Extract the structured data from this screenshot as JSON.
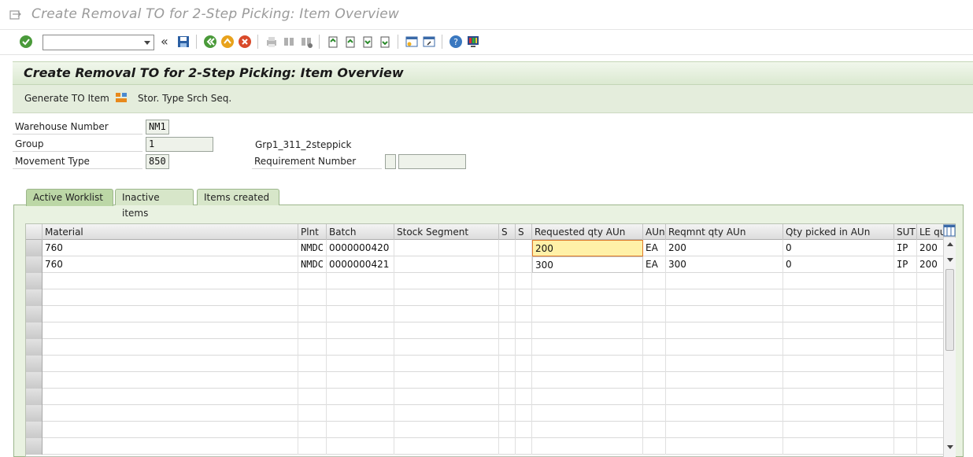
{
  "window": {
    "title": "Create Removal TO for 2-Step Picking: Item Overview"
  },
  "toolbar": {
    "command_field_value": "",
    "icons": [
      "enter-icon",
      "save-icon",
      "back-icon",
      "exit-icon",
      "cancel-icon",
      "print-icon",
      "find-icon",
      "find-next-icon",
      "first-page-icon",
      "previous-page-icon",
      "next-page-icon",
      "last-page-icon",
      "create-session-icon",
      "shortcut-icon",
      "help-icon",
      "customize-layout-icon"
    ]
  },
  "header": {
    "title": "Create Removal TO for 2-Step Picking: Item Overview"
  },
  "app_toolbar": {
    "generate_label": "Generate TO Item",
    "stor_type_label": "Stor. Type Srch Seq."
  },
  "form": {
    "warehouse_label": "Warehouse Number",
    "warehouse_value": "NM1",
    "group_label": "Group",
    "group_value": "1",
    "group_desc": "Grp1_311_2steppick",
    "movement_label": "Movement Type",
    "movement_value": "850",
    "requirement_label": "Requirement Number",
    "requirement_type": "",
    "requirement_value": ""
  },
  "tabs": [
    {
      "label": "Active Worklist",
      "active": true
    },
    {
      "label": "Inactive items",
      "active": false
    },
    {
      "label": "Items created",
      "active": false
    }
  ],
  "table": {
    "columns": [
      "Material",
      "Plnt",
      "Batch",
      "Stock Segment",
      "S",
      "S",
      "Requested qty AUn",
      "AUn",
      "Reqmnt qty AUn",
      "Qty picked in AUn",
      "SUT",
      "LE qu"
    ],
    "rows": [
      {
        "material": "760",
        "plant": "NMDC",
        "batch": "0000000420",
        "stock_segment": "",
        "s1": "",
        "s2": "",
        "requested_qty": "200",
        "aun": "EA",
        "reqmnt_qty": "200",
        "qty_picked": "0",
        "sut": "IP",
        "le_qty": "200"
      },
      {
        "material": "760",
        "plant": "NMDC",
        "batch": "0000000421",
        "stock_segment": "",
        "s1": "",
        "s2": "",
        "requested_qty": "300",
        "aun": "EA",
        "reqmnt_qty": "300",
        "qty_picked": "0",
        "sut": "IP",
        "le_qty": "200"
      }
    ]
  },
  "colors": {
    "header_green": "#dbe9d1",
    "focus_yellow": "#fff1a8",
    "focus_border": "#e07a2a"
  }
}
